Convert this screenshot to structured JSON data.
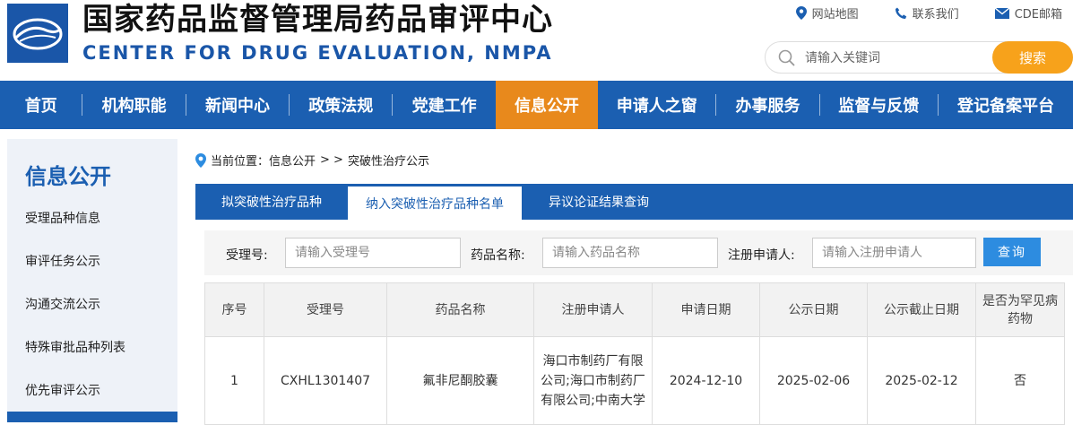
{
  "header": {
    "title_cn": "国家药品监督管理局药品审评中心",
    "title_en": "CENTER FOR DRUG EVALUATION, NMPA",
    "links": [
      {
        "label": "网站地图",
        "icon": "map-pin-icon"
      },
      {
        "label": "联系我们",
        "icon": "phone-icon"
      },
      {
        "label": "CDE邮箱",
        "icon": "mail-icon"
      }
    ],
    "search": {
      "placeholder": "请输入关键词",
      "button": "搜索"
    }
  },
  "nav": {
    "items": [
      "首页",
      "机构职能",
      "新闻中心",
      "政策法规",
      "党建工作",
      "信息公开",
      "申请人之窗",
      "办事服务",
      "监督与反馈",
      "登记备案平台"
    ],
    "active_index": 5
  },
  "sidebar": {
    "title": "信息公开",
    "items": [
      "受理品种信息",
      "审评任务公示",
      "沟通交流公示",
      "特殊审批品种列表",
      "优先审评公示"
    ]
  },
  "breadcrumb": {
    "prefix": "当前位置：信息公开",
    "sep": "> >",
    "current": "突破性治疗公示"
  },
  "tabs": [
    "拟突破性治疗品种",
    "纳入突破性治疗品种名单",
    "异议论证结果查询"
  ],
  "filter": {
    "accept_label": "受理号:",
    "accept_placeholder": "请输入受理号",
    "drug_label": "药品名称:",
    "drug_placeholder": "请输入药品名称",
    "applicant_label": "注册申请人:",
    "applicant_placeholder": "请输入注册申请人",
    "button": "查询"
  },
  "table": {
    "headers": [
      "序号",
      "受理号",
      "药品名称",
      "注册申请人",
      "申请日期",
      "公示日期",
      "公示截止日期",
      "是否为罕见病药物"
    ],
    "rows": [
      [
        "1",
        "CXHL1301407",
        "氟非尼酮胶囊",
        "海口市制药厂有限公司;海口市制药厂有限公司;中南大学",
        "2024-12-10",
        "2025-02-06",
        "2025-02-12",
        "否"
      ]
    ]
  },
  "colors": {
    "brand_blue": "#1b5fb1",
    "active_orange": "#e8891c",
    "search_orange": "#f7a21b",
    "query_blue": "#2d8ce0"
  }
}
